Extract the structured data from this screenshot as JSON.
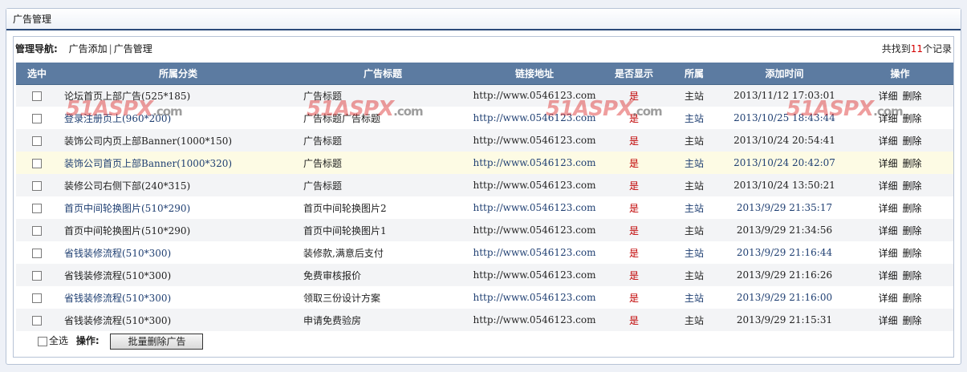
{
  "panel": {
    "title": "广告管理"
  },
  "nav": {
    "label": "管理导航:",
    "links": [
      "广告添加",
      "广告管理"
    ],
    "summary_prefix": "共找到",
    "summary_count": "11",
    "summary_suffix": "个记录"
  },
  "table": {
    "headers": [
      "选中",
      "所属分类",
      "广告标题",
      "链接地址",
      "是否显示",
      "所属",
      "添加时间",
      "操作"
    ],
    "rows": [
      {
        "category": "论坛首页上部广告(525*185)",
        "title": "广告标题",
        "link": "http://www.0546123.com",
        "show": "是",
        "site": "主站",
        "time": "2013/11/12 17:03:01",
        "op_detail": "详细",
        "op_delete": "删除"
      },
      {
        "category": "登录注册页上(960*200)",
        "title": "广告标题广告标题",
        "link": "http://www.0546123.com",
        "show": "是",
        "site": "主站",
        "time": "2013/10/25 18:43:44",
        "op_detail": "详细",
        "op_delete": "删除"
      },
      {
        "category": "装饰公司内页上部Banner(1000*150)",
        "title": "广告标题",
        "link": "http://www.0546123.com",
        "show": "是",
        "site": "主站",
        "time": "2013/10/24 20:54:41",
        "op_detail": "详细",
        "op_delete": "删除"
      },
      {
        "category": "装饰公司首页上部Banner(1000*320)",
        "title": "广告标题",
        "link": "http://www.0546123.com",
        "show": "是",
        "site": "主站",
        "time": "2013/10/24 20:42:07",
        "op_detail": "详细",
        "op_delete": "删除"
      },
      {
        "category": "装修公司右侧下部(240*315)",
        "title": "广告标题",
        "link": "http://www.0546123.com",
        "show": "是",
        "site": "主站",
        "time": "2013/10/24 13:50:21",
        "op_detail": "详细",
        "op_delete": "删除"
      },
      {
        "category": "首页中间轮换图片(510*290)",
        "title": "首页中间轮换图片2",
        "link": "http://www.0546123.com",
        "show": "是",
        "site": "主站",
        "time": "2013/9/29 21:35:17",
        "op_detail": "详细",
        "op_delete": "删除"
      },
      {
        "category": "首页中间轮换图片(510*290)",
        "title": "首页中间轮换图片1",
        "link": "http://www.0546123.com",
        "show": "是",
        "site": "主站",
        "time": "2013/9/29 21:34:56",
        "op_detail": "详细",
        "op_delete": "删除"
      },
      {
        "category": "省钱装修流程(510*300)",
        "title": "装修款,满意后支付",
        "link": "http://www.0546123.com",
        "show": "是",
        "site": "主站",
        "time": "2013/9/29 21:16:44",
        "op_detail": "详细",
        "op_delete": "删除"
      },
      {
        "category": "省钱装修流程(510*300)",
        "title": "免费审核报价",
        "link": "http://www.0546123.com",
        "show": "是",
        "site": "主站",
        "time": "2013/9/29 21:16:26",
        "op_detail": "详细",
        "op_delete": "删除"
      },
      {
        "category": "省钱装修流程(510*300)",
        "title": "领取三份设计方案",
        "link": "http://www.0546123.com",
        "show": "是",
        "site": "主站",
        "time": "2013/9/29 21:16:00",
        "op_detail": "详细",
        "op_delete": "删除"
      },
      {
        "category": "省钱装修流程(510*300)",
        "title": "申请免费验房",
        "link": "http://www.0546123.com",
        "show": "是",
        "site": "主站",
        "time": "2013/9/29 21:15:31",
        "op_detail": "详细",
        "op_delete": "删除"
      }
    ]
  },
  "footer": {
    "select_all": "全选",
    "ops_label": "操作:",
    "batch_delete": "批量删除广告"
  },
  "watermark": {
    "text": "51ASPX",
    "suffix": ".com"
  },
  "colors": {
    "header_bg": "#5c7ba1",
    "accent_dark": "#2b4a7a",
    "yes_red": "#c00000",
    "link_blue": "#1f3f72"
  }
}
